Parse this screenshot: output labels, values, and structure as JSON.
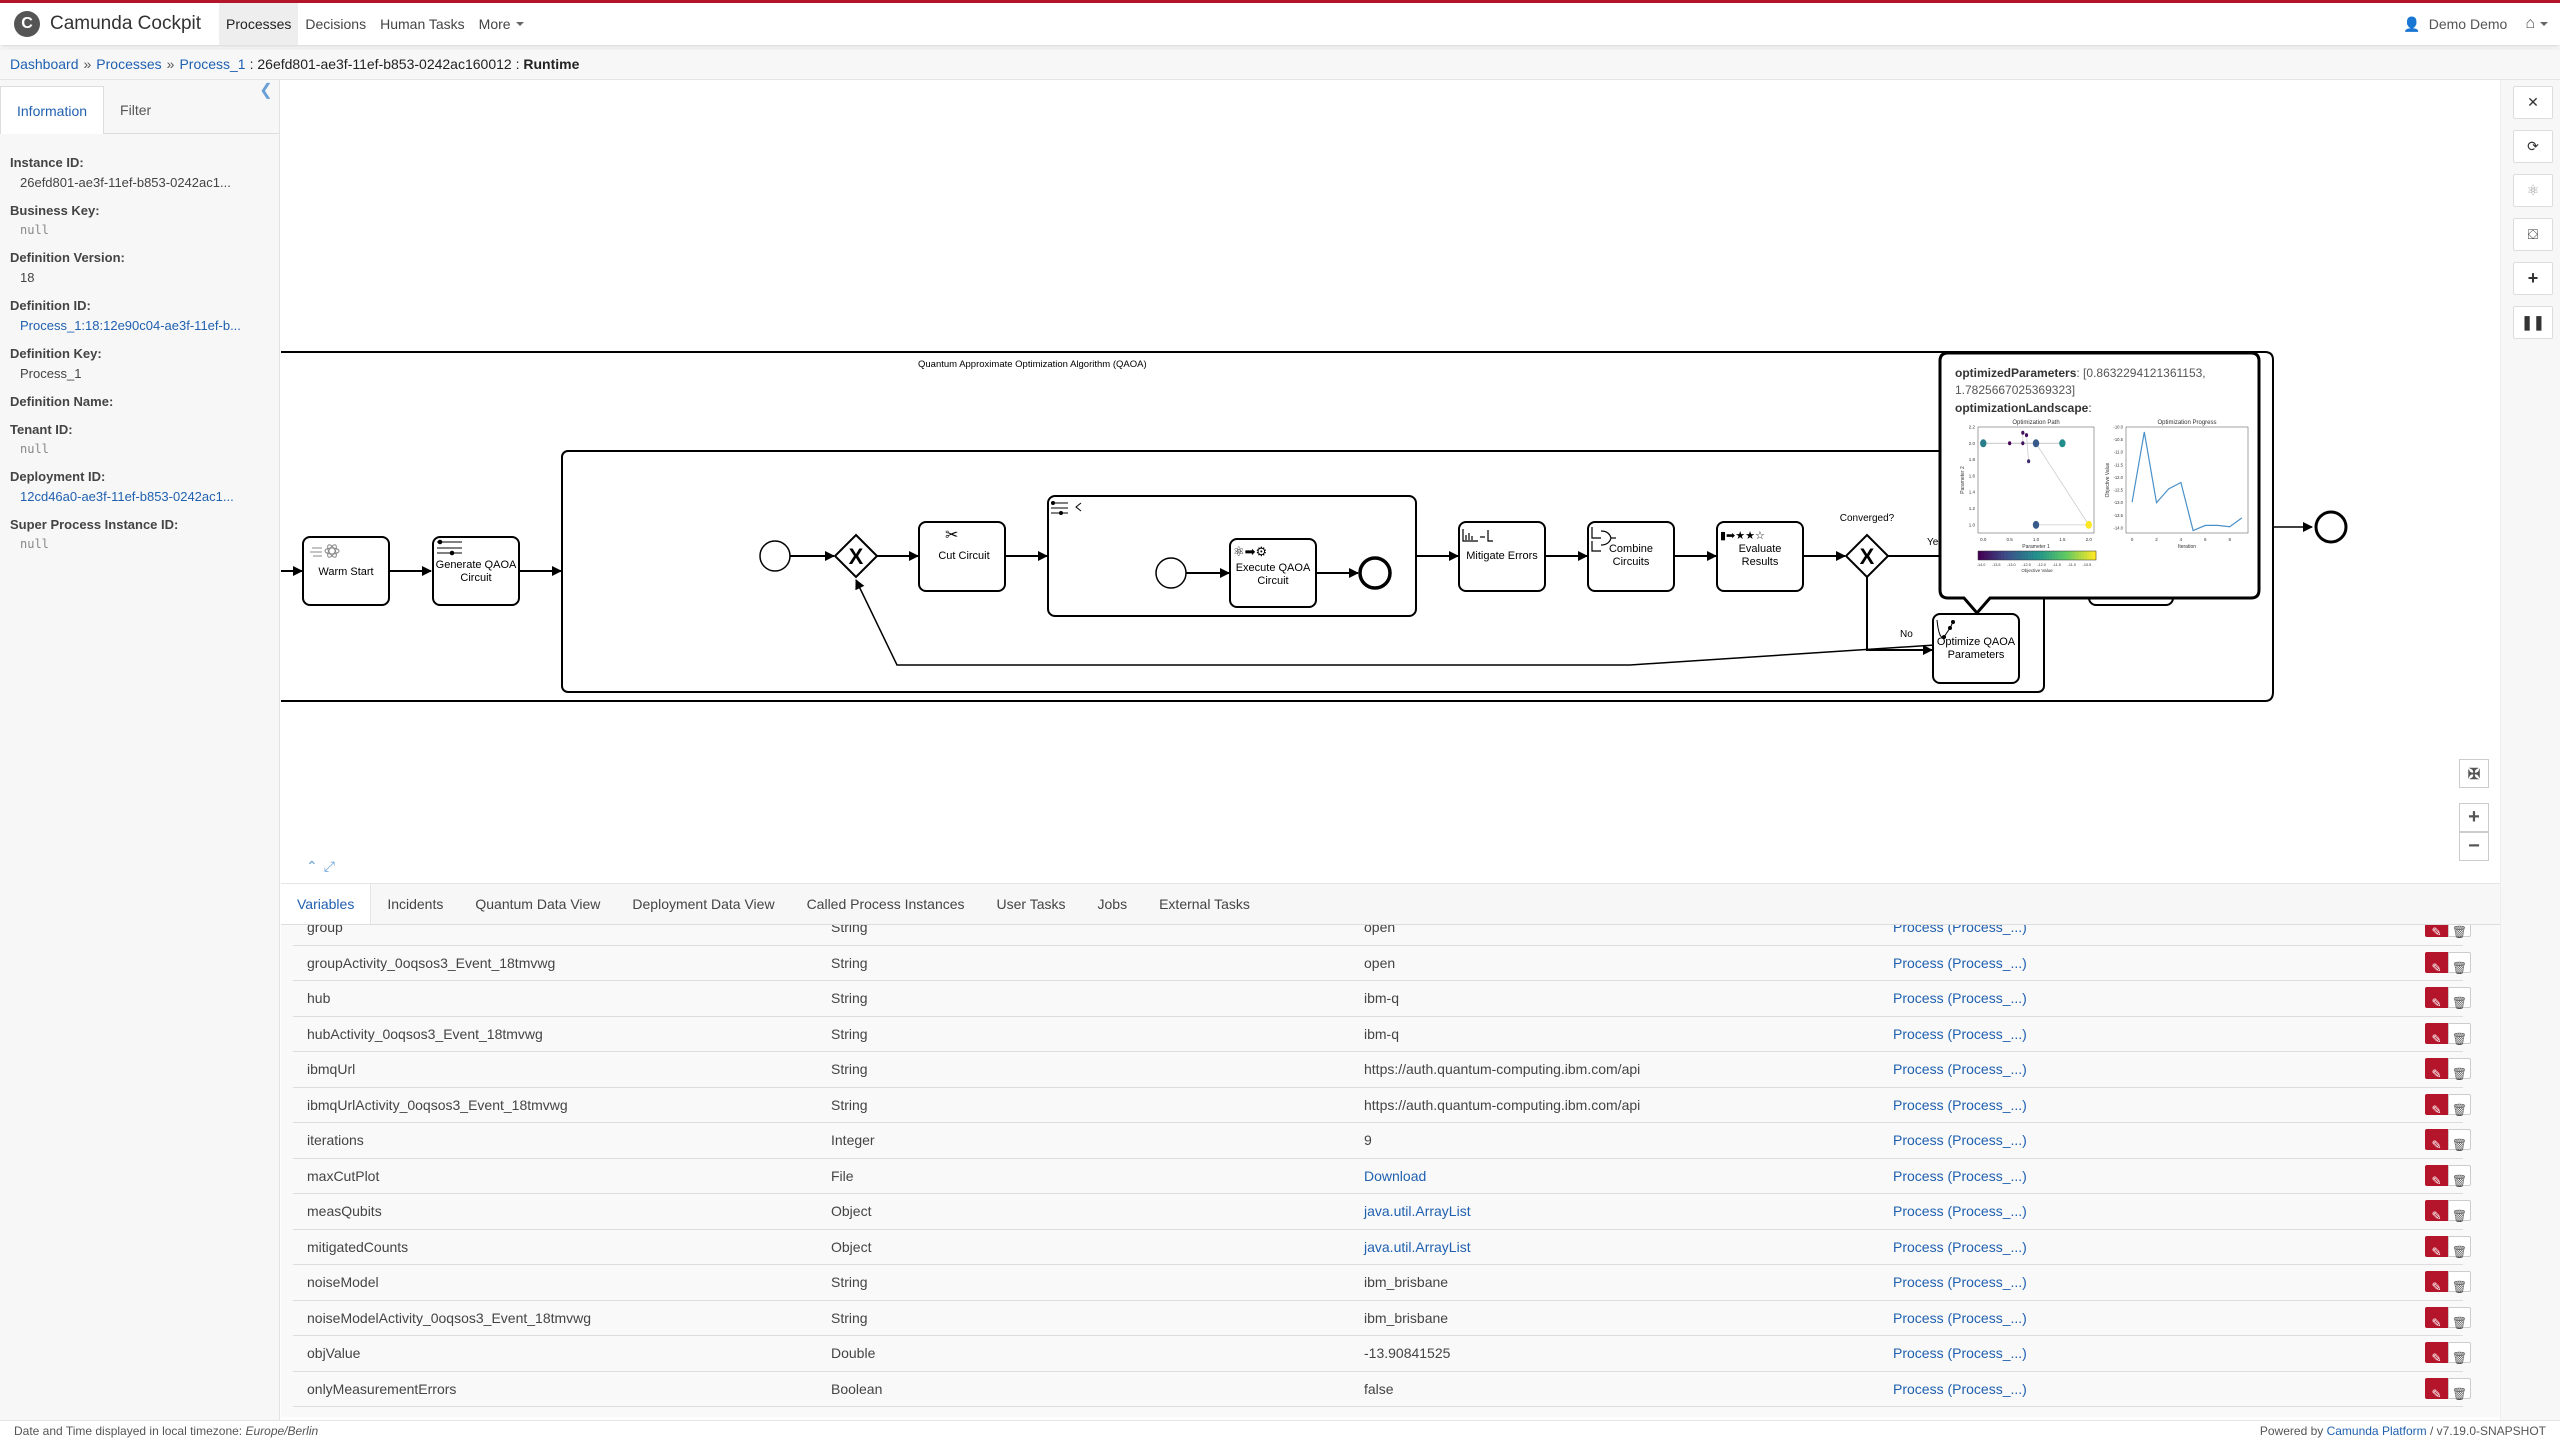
{
  "app": {
    "brand_letter": "C",
    "title": "Camunda Cockpit",
    "accent_color": "#b5152b",
    "link_color": "#1f60b0"
  },
  "nav": {
    "items": [
      {
        "label": "Processes",
        "active": true
      },
      {
        "label": "Decisions"
      },
      {
        "label": "Human Tasks"
      },
      {
        "label": "More"
      }
    ],
    "user": "Demo Demo"
  },
  "breadcrumb": {
    "items": [
      "Dashboard",
      "Processes",
      "Process_1"
    ],
    "separator": "»",
    "instance": "26efd801-ae3f-11ef-b853-0242ac160012",
    "view": "Runtime"
  },
  "sidebar": {
    "tabs": [
      "Information",
      "Filter"
    ],
    "fields": [
      {
        "label": "Instance ID:",
        "value": "26efd801-ae3f-11ef-b853-0242ac1...",
        "kind": "text"
      },
      {
        "label": "Business Key:",
        "value": "null",
        "kind": "null"
      },
      {
        "label": "Definition Version:",
        "value": "18",
        "kind": "text"
      },
      {
        "label": "Definition ID:",
        "value": "Process_1:18:12e90c04-ae3f-11ef-b...",
        "kind": "link"
      },
      {
        "label": "Definition Key:",
        "value": "Process_1",
        "kind": "text"
      },
      {
        "label": "Definition Name:",
        "value": "",
        "kind": "text"
      },
      {
        "label": "Tenant ID:",
        "value": "null",
        "kind": "null"
      },
      {
        "label": "Deployment ID:",
        "value": "12cd46a0-ae3f-11ef-b853-0242ac1...",
        "kind": "link"
      },
      {
        "label": "Super Process Instance ID:",
        "value": "null",
        "kind": "null"
      }
    ]
  },
  "diagram": {
    "pool_label": "Quantum Approximate Optimization Algorithm (QAOA)",
    "tasks": {
      "warm_start": "Warm Start",
      "generate_line1": "Generate QAOA",
      "generate_line2": "Circuit",
      "cut_circuit": "Cut Circuit",
      "execute_line1": "Execute QAOA",
      "execute_line2": "Circuit",
      "mitigate": "Mitigate Errors",
      "combine_line1": "Combine",
      "combine_line2": "Circuits",
      "evaluate_line1": "Evaluate",
      "evaluate_line2": "Results",
      "optimize_line1": "Optimize QAOA",
      "optimize_line2": "Parameters"
    },
    "gateway_label": "Converged?",
    "flow_yes": "Yes",
    "flow_no": "No",
    "popup": {
      "param_label": "optimizedParameters",
      "param_value_line1": ": [0.8632294121361153,",
      "param_value_line2": "1.7825667025369323]",
      "landscape_label": "optimizationLandscape",
      "landscape_suffix": ":"
    }
  },
  "chart_data": [
    {
      "type": "scatter",
      "title": "Optimization Path",
      "xlabel": "Parameter 1",
      "ylabel": "Parameter 2",
      "xlim": [
        -0.1,
        2.1
      ],
      "ylim": [
        0.9,
        2.2
      ],
      "xticks": [
        "0.0",
        "0.5",
        "1.0",
        "1.5",
        "2.0"
      ],
      "yticks": [
        "1.0",
        "1.2",
        "1.4",
        "1.6",
        "1.8",
        "2.0",
        "2.2"
      ],
      "points": [
        {
          "x": 1.0,
          "y": 1.0,
          "value": -12.98
        },
        {
          "x": 2.0,
          "y": 1.0,
          "value": -10.2
        },
        {
          "x": 1.0,
          "y": 2.0,
          "value": -13.0
        },
        {
          "x": 0.0,
          "y": 2.0,
          "value": -12.45
        },
        {
          "x": 1.5,
          "y": 2.0,
          "value": -12.2
        },
        {
          "x": 0.5,
          "y": 2.0,
          "value": -14.1
        },
        {
          "x": 0.75,
          "y": 2.0,
          "value": -13.9
        },
        {
          "x": 0.75,
          "y": 2.13,
          "value": -13.9
        },
        {
          "x": 0.82,
          "y": 2.1,
          "value": -13.95
        },
        {
          "x": 0.86,
          "y": 1.78,
          "value": -13.6
        }
      ],
      "colorbar": {
        "label": "Objective Value",
        "range": [
          -14.1,
          -10.2
        ],
        "ticks": [
          "-14.0",
          "-13.5",
          "-13.0",
          "-12.5",
          "-12.0",
          "-11.5",
          "-11.0",
          "-10.5"
        ]
      }
    },
    {
      "type": "line",
      "title": "Optimization Progress",
      "xlabel": "Iteration",
      "ylabel": "Objective Value",
      "xlim": [
        -0.5,
        9.5
      ],
      "ylim": [
        -14.2,
        -10.0
      ],
      "xticks": [
        "0",
        "2",
        "4",
        "6",
        "8"
      ],
      "yticks": [
        "-10.0",
        "-10.5",
        "-11.0",
        "-11.5",
        "-12.0",
        "-12.5",
        "-13.0",
        "-13.5",
        "-14.0"
      ],
      "x": [
        0,
        1,
        2,
        3,
        4,
        5,
        6,
        7,
        8,
        9
      ],
      "series": [
        {
          "name": "Objective Value",
          "color": "#4a90c8",
          "values": [
            -12.98,
            -10.2,
            -13.0,
            -12.45,
            -12.2,
            -14.1,
            -13.9,
            -13.9,
            -13.95,
            -13.6
          ]
        }
      ]
    }
  ],
  "bottom_tabs": [
    "Variables",
    "Incidents",
    "Quantum Data View",
    "Deployment Data View",
    "Called Process Instances",
    "User Tasks",
    "Jobs",
    "External Tasks"
  ],
  "variables": [
    {
      "name": "group",
      "type": "String",
      "value": "open",
      "value_link": false,
      "scope": "Process (Process_...)"
    },
    {
      "name": "groupActivity_0oqsos3_Event_18tmvwg",
      "type": "String",
      "value": "open",
      "value_link": false,
      "scope": "Process (Process_...)"
    },
    {
      "name": "hub",
      "type": "String",
      "value": "ibm-q",
      "value_link": false,
      "scope": "Process (Process_...)"
    },
    {
      "name": "hubActivity_0oqsos3_Event_18tmvwg",
      "type": "String",
      "value": "ibm-q",
      "value_link": false,
      "scope": "Process (Process_...)"
    },
    {
      "name": "ibmqUrl",
      "type": "String",
      "value": "https://auth.quantum-computing.ibm.com/api",
      "value_link": false,
      "scope": "Process (Process_...)"
    },
    {
      "name": "ibmqUrlActivity_0oqsos3_Event_18tmvwg",
      "type": "String",
      "value": "https://auth.quantum-computing.ibm.com/api",
      "value_link": false,
      "scope": "Process (Process_...)"
    },
    {
      "name": "iterations",
      "type": "Integer",
      "value": "9",
      "value_link": false,
      "scope": "Process (Process_...)"
    },
    {
      "name": "maxCutPlot",
      "type": "File",
      "value": "Download",
      "value_link": true,
      "scope": "Process (Process_...)"
    },
    {
      "name": "measQubits",
      "type": "Object",
      "value": "java.util.ArrayList",
      "value_link": true,
      "scope": "Process (Process_...)"
    },
    {
      "name": "mitigatedCounts",
      "type": "Object",
      "value": "java.util.ArrayList",
      "value_link": true,
      "scope": "Process (Process_...)"
    },
    {
      "name": "noiseModel",
      "type": "String",
      "value": "ibm_brisbane",
      "value_link": false,
      "scope": "Process (Process_...)"
    },
    {
      "name": "noiseModelActivity_0oqsos3_Event_18tmvwg",
      "type": "String",
      "value": "ibm_brisbane",
      "value_link": false,
      "scope": "Process (Process_...)"
    },
    {
      "name": "objValue",
      "type": "Double",
      "value": "-13.90841525",
      "value_link": false,
      "scope": "Process (Process_...)"
    },
    {
      "name": "onlyMeasurementErrors",
      "type": "Boolean",
      "value": "false",
      "value_link": false,
      "scope": "Process (Process_...)"
    }
  ],
  "footer": {
    "timezone_prefix": "Date and Time displayed in local timezone: ",
    "timezone": "Europe/Berlin",
    "powered_prefix": "Powered by ",
    "platform": "Camunda Platform",
    "version": " / v7.19.0-SNAPSHOT"
  }
}
